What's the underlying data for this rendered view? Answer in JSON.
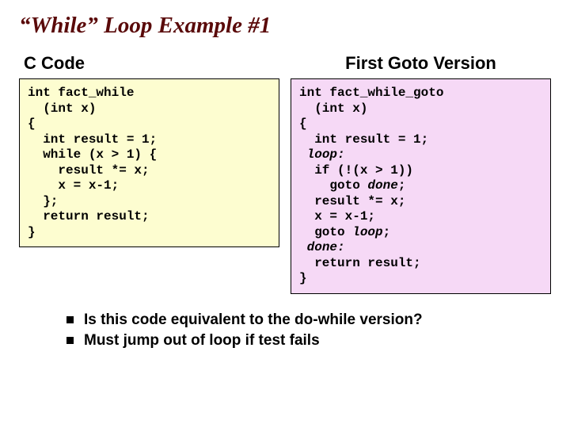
{
  "title": "“While” Loop Example #1",
  "left": {
    "heading": "C Code",
    "code": "int fact_while\n  (int x)\n{\n  int result = 1;\n  while (x > 1) {\n    result *= x;\n    x = x-1;\n  };\n  return result;\n}"
  },
  "right": {
    "heading": "First Goto Version",
    "code_pre1": "int fact_while_goto\n  (int x)\n{\n  int result = 1;\n ",
    "kw_loop": "loop:",
    "code_mid1": "\n  if (!(x > 1))\n    goto ",
    "kw_done1": "done",
    "code_mid2": ";\n  result *= x;\n  x = x-1;\n  goto ",
    "kw_loop2": "loop",
    "code_mid3": ";\n ",
    "kw_done2": "done:",
    "code_post": "\n  return result;\n}"
  },
  "bullets": [
    "Is this code equivalent to the do-while version?",
    "Must jump out of loop if test fails"
  ]
}
